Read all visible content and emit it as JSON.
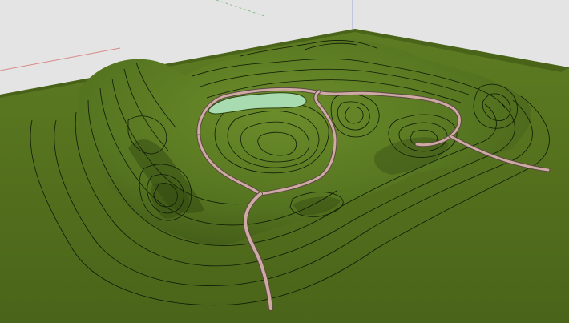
{
  "viewport": {
    "background_color": "#e4e4e4",
    "terrain_color": "#4f6a1c",
    "terrain_highlight_color": "#6b8a2a",
    "terrain_shadow_color": "#2f4410",
    "contour_line_color": "#0f1a06",
    "path_color": "#cfa9a4",
    "path_edge_color": "#5b4a44",
    "pond_color": "#a8dbb0",
    "axis_red": "#d98a8a",
    "axis_green": "#8fbf8f",
    "axis_blue": "#9aa6d8"
  },
  "scene": {
    "objects": [
      "terrain-mesh",
      "contour-lines",
      "ring-path",
      "access-path",
      "pond"
    ]
  }
}
